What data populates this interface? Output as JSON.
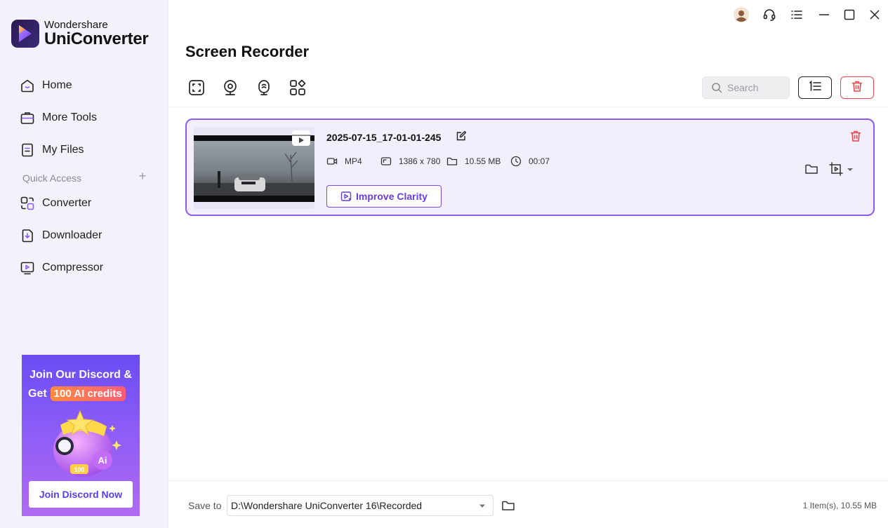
{
  "app": {
    "brand": "Wondershare",
    "product": "UniConverter"
  },
  "sidebar": {
    "items": [
      {
        "label": "Home",
        "icon": "home-icon"
      },
      {
        "label": "More Tools",
        "icon": "toolbox-icon"
      },
      {
        "label": "My Files",
        "icon": "file-icon"
      }
    ],
    "quick_access_label": "Quick Access",
    "quick_items": [
      {
        "label": "Converter",
        "icon": "converter-icon"
      },
      {
        "label": "Downloader",
        "icon": "downloader-icon"
      },
      {
        "label": "Compressor",
        "icon": "compressor-icon"
      }
    ],
    "promo": {
      "line1": "Join Our Discord &",
      "line2_prefix": "Get",
      "badge": "100 AI credits",
      "art_number": "100",
      "art_logo": "Ai",
      "button": "Join Discord Now"
    }
  },
  "header": {
    "title": "Screen Recorder",
    "search_placeholder": "Search"
  },
  "recording": {
    "file_name": "2025-07-15_17-01-01-245",
    "format": "MP4",
    "resolution": "1386 x 780",
    "size": "10.55 MB",
    "duration": "00:07",
    "improve_label": "Improve Clarity"
  },
  "footer": {
    "save_label": "Save to",
    "path": "D:\\Wondershare UniConverter 16\\Recorded",
    "status": "1 Item(s), 10.55 MB"
  },
  "colors": {
    "accent": "#8c5cf0",
    "danger": "#e8474d",
    "sidebar_bg": "#f3f2fa"
  }
}
